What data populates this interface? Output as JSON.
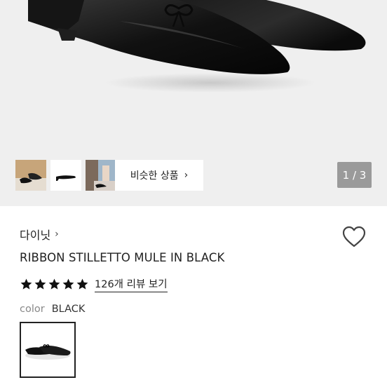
{
  "gallery": {
    "counter": "1 / 3",
    "similar_label": "비슷한 상품",
    "similar_chevron": "›",
    "thumbnails": [
      {
        "name": "thumb-shoes-pair"
      },
      {
        "name": "thumb-shoe-side"
      },
      {
        "name": "thumb-model-wearing"
      }
    ]
  },
  "product": {
    "brand": "다이닛",
    "brand_chevron": "›",
    "title": "RIBBON STILLETTO MULE IN BLACK",
    "rating": {
      "stars": 5,
      "review_link": "126개 리뷰 보기"
    },
    "color": {
      "label": "color",
      "value": "BLACK"
    }
  },
  "colors": {
    "hero_bg": "#efefef",
    "counter_bg": "#9a9a9a",
    "text": "#222222",
    "muted": "#888888"
  },
  "icons": {
    "wishlist": "heart-outline-icon",
    "star": "star-filled-icon",
    "chevron": "chevron-right-icon"
  }
}
